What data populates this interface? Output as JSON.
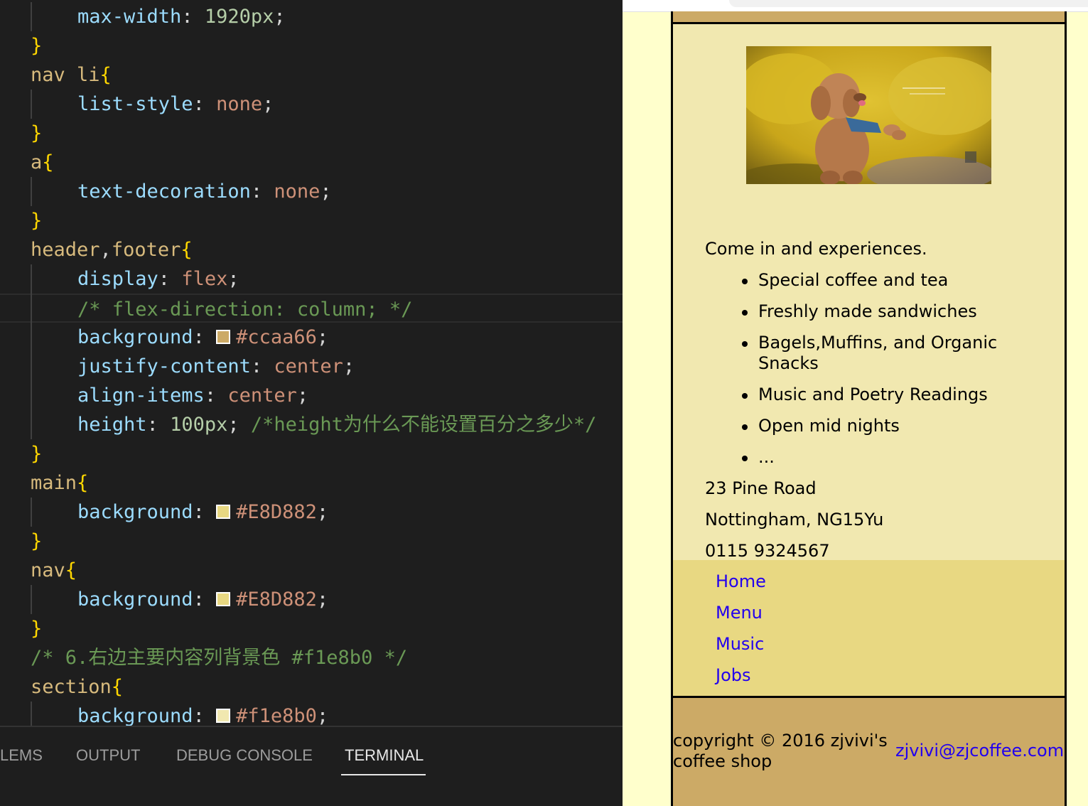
{
  "editor": {
    "lines": [
      {
        "indent": true,
        "tokens": [
          [
            "max-width",
            "prop"
          ],
          [
            ": ",
            "punc"
          ],
          [
            "1920px",
            "num"
          ],
          [
            ";",
            "punc"
          ]
        ]
      },
      {
        "indent": false,
        "tokens": [
          [
            "}",
            "brace"
          ]
        ]
      },
      {
        "indent": false,
        "tokens": [
          [
            "nav li",
            "sel"
          ],
          [
            "{",
            "brace"
          ]
        ]
      },
      {
        "indent": true,
        "tokens": [
          [
            "list-style",
            "prop"
          ],
          [
            ": ",
            "punc"
          ],
          [
            "none",
            "val"
          ],
          [
            ";",
            "punc"
          ]
        ]
      },
      {
        "indent": false,
        "tokens": [
          [
            "}",
            "brace"
          ]
        ]
      },
      {
        "indent": false,
        "tokens": [
          [
            "a",
            "sel"
          ],
          [
            "{",
            "brace"
          ]
        ]
      },
      {
        "indent": true,
        "tokens": [
          [
            "text-decoration",
            "prop"
          ],
          [
            ": ",
            "punc"
          ],
          [
            "none",
            "val"
          ],
          [
            ";",
            "punc"
          ]
        ]
      },
      {
        "indent": false,
        "tokens": [
          [
            "}",
            "brace"
          ]
        ]
      },
      {
        "indent": false,
        "tokens": [
          [
            "header",
            "sel"
          ],
          [
            ",",
            "punc"
          ],
          [
            "footer",
            "sel"
          ],
          [
            "{",
            "brace"
          ]
        ]
      },
      {
        "indent": true,
        "tokens": [
          [
            "display",
            "prop"
          ],
          [
            ": ",
            "punc"
          ],
          [
            "flex",
            "val"
          ],
          [
            ";",
            "punc"
          ]
        ]
      },
      {
        "indent": true,
        "active": true,
        "tokens": [
          [
            "/* flex-direction: column; */",
            "com"
          ]
        ]
      },
      {
        "indent": true,
        "tokens": [
          [
            "background",
            "prop"
          ],
          [
            ": ",
            "punc"
          ],
          [
            "#ccaa66",
            "swatch:#ccaa66"
          ],
          [
            ";",
            "punc"
          ]
        ]
      },
      {
        "indent": true,
        "tokens": [
          [
            "justify-content",
            "prop"
          ],
          [
            ": ",
            "punc"
          ],
          [
            "center",
            "val"
          ],
          [
            ";",
            "punc"
          ]
        ]
      },
      {
        "indent": true,
        "tokens": [
          [
            "align-items",
            "prop"
          ],
          [
            ": ",
            "punc"
          ],
          [
            "center",
            "val"
          ],
          [
            ";",
            "punc"
          ]
        ]
      },
      {
        "indent": true,
        "tokens": [
          [
            "height",
            "prop"
          ],
          [
            ": ",
            "punc"
          ],
          [
            "100px",
            "num"
          ],
          [
            "; ",
            "punc"
          ],
          [
            "/*height为什么不能设置百分之多少*/",
            "com"
          ]
        ]
      },
      {
        "indent": false,
        "tokens": [
          [
            "}",
            "brace"
          ]
        ]
      },
      {
        "indent": false,
        "tokens": [
          [
            "main",
            "sel"
          ],
          [
            "{",
            "brace"
          ]
        ]
      },
      {
        "indent": true,
        "tokens": [
          [
            "background",
            "prop"
          ],
          [
            ": ",
            "punc"
          ],
          [
            "#E8D882",
            "swatch:#E8D882"
          ],
          [
            ";",
            "punc"
          ]
        ]
      },
      {
        "indent": false,
        "tokens": [
          [
            "}",
            "brace"
          ]
        ]
      },
      {
        "indent": false,
        "tokens": [
          [
            "nav",
            "sel"
          ],
          [
            "{",
            "brace"
          ]
        ]
      },
      {
        "indent": true,
        "tokens": [
          [
            "background",
            "prop"
          ],
          [
            ": ",
            "punc"
          ],
          [
            "#E8D882",
            "swatch:#E8D882"
          ],
          [
            ";",
            "punc"
          ]
        ]
      },
      {
        "indent": false,
        "tokens": [
          [
            "}",
            "brace"
          ]
        ]
      },
      {
        "indent": false,
        "tokens": [
          [
            "/* 6.右边主要内容列背景色 #f1e8b0 */",
            "com"
          ]
        ]
      },
      {
        "indent": false,
        "tokens": [
          [
            "section",
            "sel"
          ],
          [
            "{",
            "brace"
          ]
        ]
      },
      {
        "indent": true,
        "tokens": [
          [
            "background",
            "prop"
          ],
          [
            ": ",
            "punc"
          ],
          [
            "#f1e8b0",
            "swatch:#f1e8b0"
          ],
          [
            ";",
            "punc"
          ]
        ]
      }
    ]
  },
  "panel": {
    "tabs": [
      {
        "label": "LEMS",
        "active": false
      },
      {
        "label": "OUTPUT",
        "active": false
      },
      {
        "label": "DEBUG CONSOLE",
        "active": false
      },
      {
        "label": "TERMINAL",
        "active": true
      }
    ]
  },
  "site": {
    "intro": "Come in and experiences.",
    "features": [
      "Special coffee and tea",
      "Freshly made sandwiches",
      "Bagels,Muffins, and Organic Snacks",
      "Music and Poetry Readings",
      "Open mid nights",
      "..."
    ],
    "address": {
      "street": "23 Pine Road",
      "city": "Nottingham, NG15Yu",
      "phone": "0115 9324567"
    },
    "nav": [
      "Home",
      "Menu",
      "Music",
      "Jobs"
    ],
    "footer": {
      "copyright": "copyright © 2016 zjvivi's coffee shop",
      "email": "zjvivi@zjcoffee.com"
    },
    "colors": {
      "header_footer": "#ccaa66",
      "nav": "#E8D882",
      "section": "#f1e8b0",
      "page_bg": "#ffffcc",
      "link": "#2200ee"
    },
    "image": "poodle-photo"
  }
}
